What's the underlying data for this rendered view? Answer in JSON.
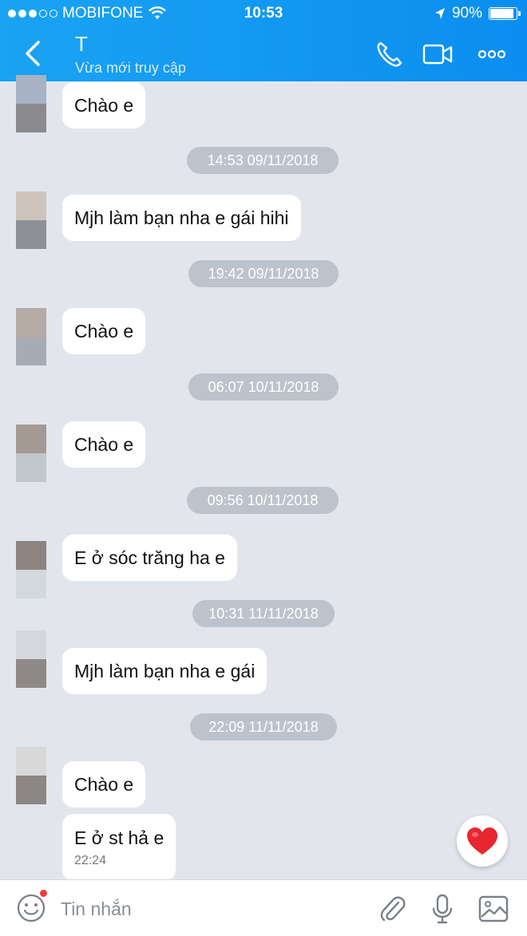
{
  "status_bar": {
    "carrier": "MOBIFONE",
    "time": "10:53",
    "battery": "90%",
    "battery_level": 0.9
  },
  "header": {
    "contact_name": "T",
    "contact_status": "Vừa mới truy cập"
  },
  "messages": [
    {
      "text": "Chào e"
    },
    {
      "stamp": "14:53 09/11/2018"
    },
    {
      "text": "Mjh làm bạn nha e gái hihi"
    },
    {
      "stamp": "19:42 09/11/2018"
    },
    {
      "text": "Chào e"
    },
    {
      "stamp": "06:07 10/11/2018"
    },
    {
      "text": "Chào e"
    },
    {
      "stamp": "09:56 10/11/2018"
    },
    {
      "text": "E ở sóc trăng ha e"
    },
    {
      "stamp": "10:31 11/11/2018"
    },
    {
      "text": "Mjh làm bạn nha e gái"
    },
    {
      "stamp": "22:09 11/11/2018"
    },
    {
      "text": "Chào e"
    },
    {
      "text": "E ở st hả e",
      "time": "22:24"
    }
  ],
  "composer": {
    "placeholder": "Tin nhắn"
  },
  "colors": {
    "header": "#0a8ef0",
    "background": "#e2e6ec",
    "stamp": "#bcc3cd",
    "heart": "#e8262f"
  },
  "icons": [
    "back-icon",
    "phone-icon",
    "video-icon",
    "more-icon",
    "emoji-icon",
    "attach-icon",
    "mic-icon",
    "image-icon",
    "heart-icon",
    "wifi-icon",
    "location-icon"
  ]
}
